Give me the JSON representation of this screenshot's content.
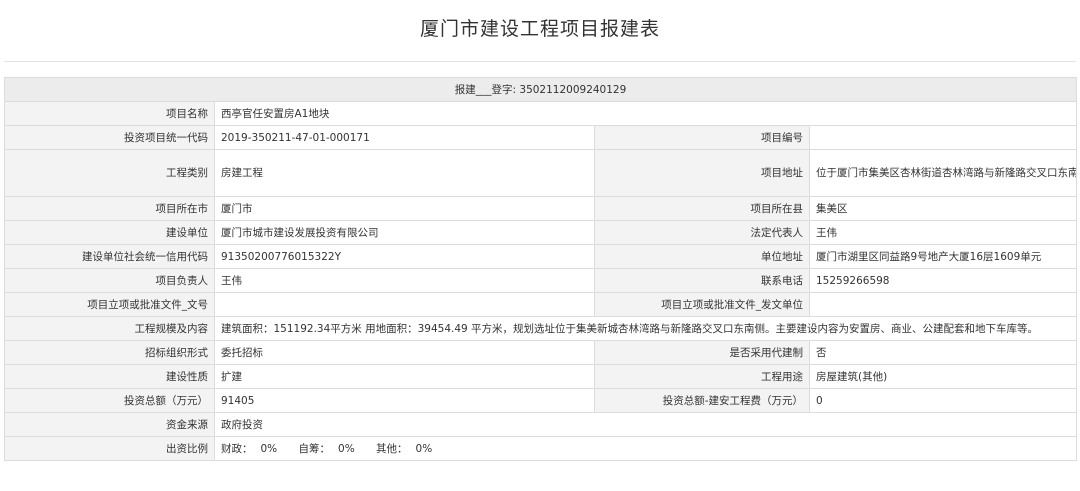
{
  "title": "厦门市建设工程项目报建表",
  "header": {
    "label": "报建___登字:",
    "number": "3502112009240129"
  },
  "rows": {
    "project_name": {
      "label": "项目名称",
      "value": "西亭官任安置房A1地块"
    },
    "investment_code": {
      "label": "投资项目统一代码",
      "value": "2019-350211-47-01-000171"
    },
    "project_number": {
      "label": "项目编号",
      "value": ""
    },
    "project_category": {
      "label": "工程类别",
      "value": "房建工程"
    },
    "project_address": {
      "label": "项目地址",
      "value": "位于厦门市集美区杏林街道杏林湾路与新隆路交叉口东南侧"
    },
    "project_city": {
      "label": "项目所在市",
      "value": "厦门市"
    },
    "project_county": {
      "label": "项目所在县",
      "value": "集美区"
    },
    "builder": {
      "label": "建设单位",
      "value": "厦门市城市建设发展投资有限公司"
    },
    "legal_rep": {
      "label": "法定代表人",
      "value": "王伟"
    },
    "credit_code": {
      "label": "建设单位社会统一信用代码",
      "value": "91350200776015322Y"
    },
    "unit_address": {
      "label": "单位地址",
      "value": "厦门市湖里区同益路9号地产大厦16层1609单元"
    },
    "project_leader": {
      "label": "项目负责人",
      "value": "王伟"
    },
    "phone": {
      "label": "联系电话",
      "value": "15259266598"
    },
    "approval_doc": {
      "label": "项目立项或批准文件_文号",
      "value": ""
    },
    "approval_unit": {
      "label": "项目立项或批准文件_发文单位",
      "value": ""
    },
    "scale": {
      "label": "工程规模及内容",
      "value": "建筑面积：151192.34平方米 用地面积：39454.49 平方米，规划选址位于集美新城杏林湾路与新隆路交叉口东南侧。主要建设内容为安置房、商业、公建配套和地下车库等。"
    },
    "bidding_form": {
      "label": "招标组织形式",
      "value": "委托招标"
    },
    "agent_build": {
      "label": "是否采用代建制",
      "value": "否"
    },
    "construction_nature": {
      "label": "建设性质",
      "value": "扩建"
    },
    "usage": {
      "label": "工程用途",
      "value": "房屋建筑(其他)"
    },
    "total_investment": {
      "label": "投资总额（万元）",
      "value": "91405"
    },
    "construction_cost": {
      "label": "投资总额-建安工程费（万元）",
      "value": "0"
    },
    "fund_source": {
      "label": "资金来源",
      "value": "政府投资"
    },
    "contribution_ratio": {
      "label": "出资比例",
      "items": [
        {
          "label": "财政：",
          "value": "0%"
        },
        {
          "label": "自筹：",
          "value": "0%"
        },
        {
          "label": "其他：",
          "value": "0%"
        }
      ]
    }
  }
}
